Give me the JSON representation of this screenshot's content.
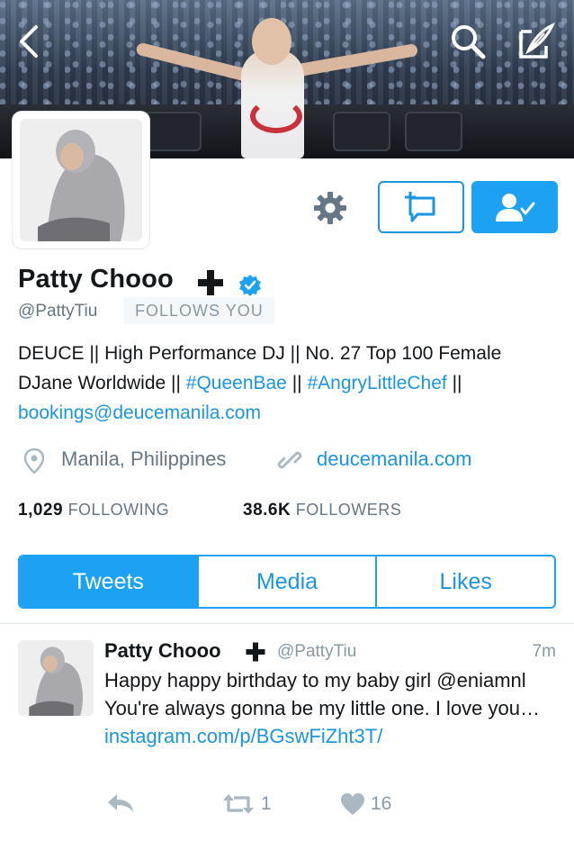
{
  "header": {
    "back_icon": "chevron-left-icon",
    "search_icon": "search-icon",
    "compose_icon": "compose-icon"
  },
  "profile": {
    "name": "Patty Chooo",
    "name_symbol": "plus-icon",
    "verified": true,
    "handle": "@PattyTiu",
    "follows_you": "FOLLOWS YOU",
    "bio": {
      "part1": "DEUCE || High Performance DJ || No. 27 Top 100 Female DJane Worldwide || ",
      "hashtag1": "#QueenBae",
      "part2": " || ",
      "hashtag2": "#AngryLittleChef",
      "part3": " || ",
      "email": "bookings@deucemanila.com"
    },
    "location": "Manila, Philippines",
    "website": "deucemanila.com",
    "following_count": "1,029",
    "following_label": "FOLLOWING",
    "followers_count": "38.6K",
    "followers_label": "FOLLOWERS"
  },
  "tabs": [
    {
      "label": "Tweets",
      "active": true
    },
    {
      "label": "Media",
      "active": false
    },
    {
      "label": "Likes",
      "active": false
    }
  ],
  "tweet": {
    "name": "Patty Chooo",
    "handle": "@PattyTiu",
    "time": "7m",
    "text_plain": "Happy happy birthday to my baby girl @eniamnl You're always gonna be my little one. I love you… ",
    "text_link": "instagram.com/p/BGswFiZht3T/",
    "retweets": "1",
    "likes": "16"
  },
  "colors": {
    "accent": "#1da1f2",
    "link": "#1b95e0",
    "muted": "#657786"
  }
}
